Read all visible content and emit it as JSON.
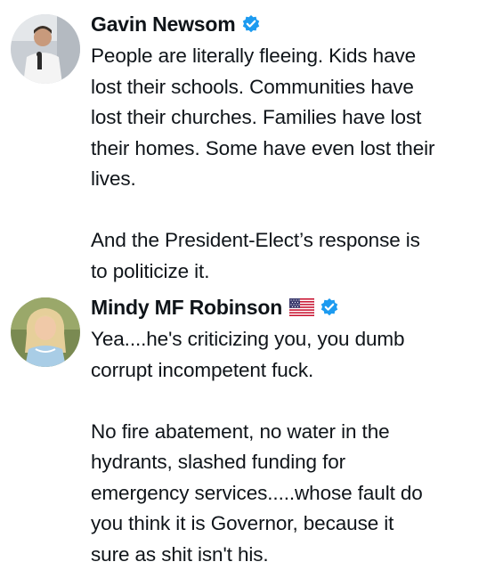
{
  "posts": [
    {
      "author": {
        "name": "Gavin Newsom",
        "verified": true,
        "badge_color": "#1d9bf0",
        "avatar_icon": "avatar-photo-man-speaking"
      },
      "text": "People are literally fleeing. Kids have\nlost their schools. Communities have\nlost their churches. Families have lost\ntheir homes. Some have even lost their\nlives.\n\nAnd the President-Elect’s response is\nto politicize it."
    },
    {
      "author": {
        "name": "Mindy MF Robinson",
        "flag_icon": "us-flag-icon",
        "verified": true,
        "badge_color": "#1d9bf0",
        "avatar_icon": "avatar-photo-blonde-woman"
      },
      "text": "Yea....he's criticizing you, you dumb\ncorrupt incompetent fuck.\n\nNo fire abatement, no water in the\nhydrants, slashed funding for\nemergency services.....whose fault do\nyou think it is Governor, because it\nsure as shit isn't his."
    }
  ]
}
